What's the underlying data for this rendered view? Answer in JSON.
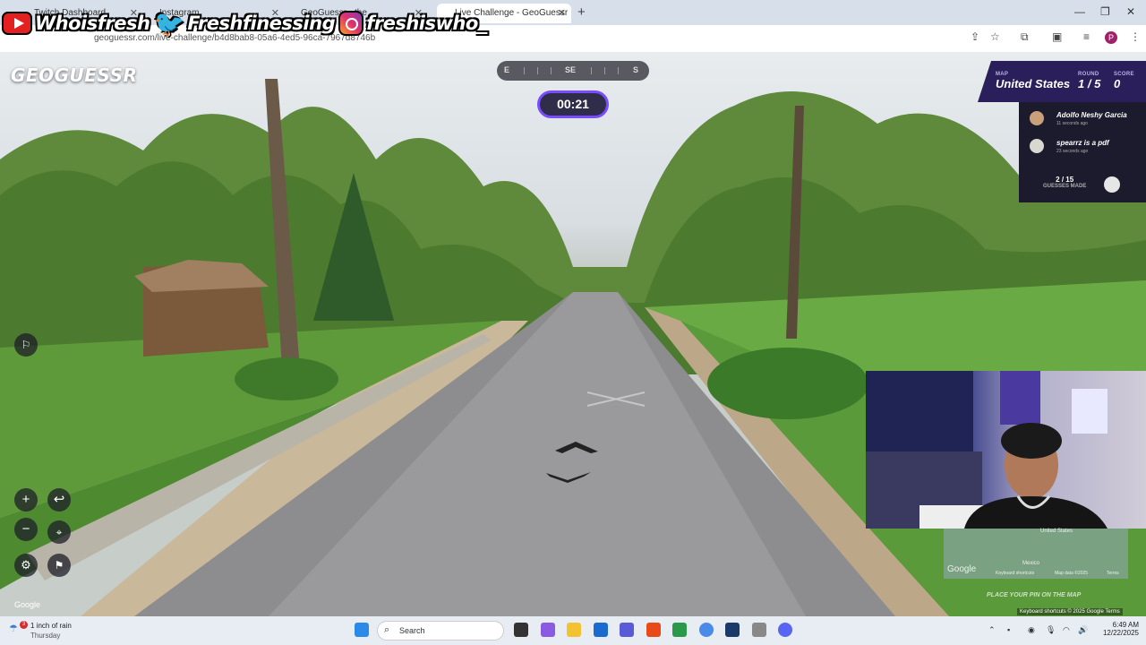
{
  "browser": {
    "tabs": [
      {
        "label": "Twitch Dashboard"
      },
      {
        "label": "Instagram"
      },
      {
        "label": "GeoGuessr - the"
      },
      {
        "label": "Live Challenge - GeoGuessr"
      }
    ],
    "url": "geoguessr.com/live-challenge/b4d8bab8-05a6-4ed5-96ca-7967d8746b",
    "profile_initial": "P"
  },
  "social": {
    "youtube": "Whoisfresh",
    "twitter": "Freshfinessing",
    "instagram": "freshiswho_"
  },
  "game": {
    "logo": "GEOGUESSR",
    "compass": {
      "left": "E",
      "center": "SE",
      "right": "S"
    },
    "timer": "00:21",
    "status": {
      "map_label": "MAP",
      "map_value": "United States",
      "round_label": "ROUND",
      "round_value": "1 / 5",
      "score_label": "SCORE",
      "score_value": "0"
    },
    "players": [
      {
        "name": "Adolfo Neshy Garcia",
        "time": "11 seconds ago"
      },
      {
        "name": "spearrz is a pdf",
        "time": "23 seconds ago"
      }
    ],
    "guesses": {
      "count": "2 / 15",
      "label": "GUESSES MADE"
    },
    "minimap": {
      "place_pin": "PLACE YOUR PIN ON THE MAP",
      "country": "United States",
      "country2": "Mexico",
      "google": "Google",
      "shortcuts": "Keyboard shortcuts",
      "mapdata": "Map data ©2025",
      "terms": "Terms"
    },
    "watermark": "Google",
    "attribution": "Keyboard shortcuts   © 2025 Google   Terms"
  },
  "taskbar": {
    "weather_temp": "1 inch of rain",
    "weather_day": "Thursday",
    "weather_badge": "3",
    "search": "Search",
    "time": "6:49 AM",
    "date": "12/22/2025"
  }
}
